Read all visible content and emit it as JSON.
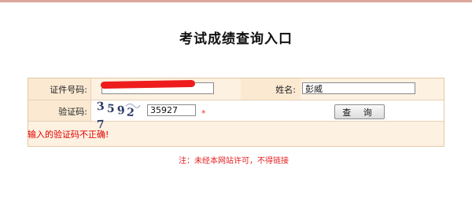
{
  "page": {
    "title": "考试成绩查询入口",
    "note": "注：未经本网站许可，不得链接"
  },
  "form": {
    "id_label": "证件号码:",
    "id_value": "",
    "name_label": "姓名:",
    "name_value": "彭威",
    "captcha_label": "验证码:",
    "captcha_image_chars": [
      "3",
      "5",
      "9",
      "2",
      "7"
    ],
    "captcha_value": "35927",
    "required_mark": "*",
    "submit_label": "查 询",
    "error_message": "输入的验证码不正确!"
  },
  "colors": {
    "accent_border": "#e3c8a2",
    "panel_bg": "#fdf1e1",
    "error": "#e30000",
    "captcha_text": "#2d3a67"
  }
}
